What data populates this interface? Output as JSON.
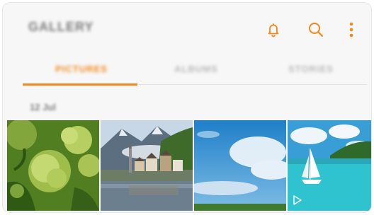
{
  "app": {
    "title": "GALLERY"
  },
  "toolbar": {
    "notifications_icon": "bell-icon",
    "search_icon": "search-icon",
    "more_icon": "more-vertical-icon"
  },
  "tabs": [
    {
      "label": "PICTURES",
      "selected": true
    },
    {
      "label": "ALBUMS",
      "selected": false
    },
    {
      "label": "STORIES",
      "selected": false
    }
  ],
  "section": {
    "date": "12 Jul"
  },
  "photos": [
    {
      "subject": "green flower buds",
      "is_video": false
    },
    {
      "subject": "lakeside alpine village",
      "is_video": false
    },
    {
      "subject": "blue sky with clouds",
      "is_video": false
    },
    {
      "subject": "sailboat on turquoise sea",
      "is_video": true
    }
  ],
  "colors": {
    "accent": "#f08a1c",
    "background": "#f7f7f7",
    "inactive_tab": "#b8b8b8"
  }
}
